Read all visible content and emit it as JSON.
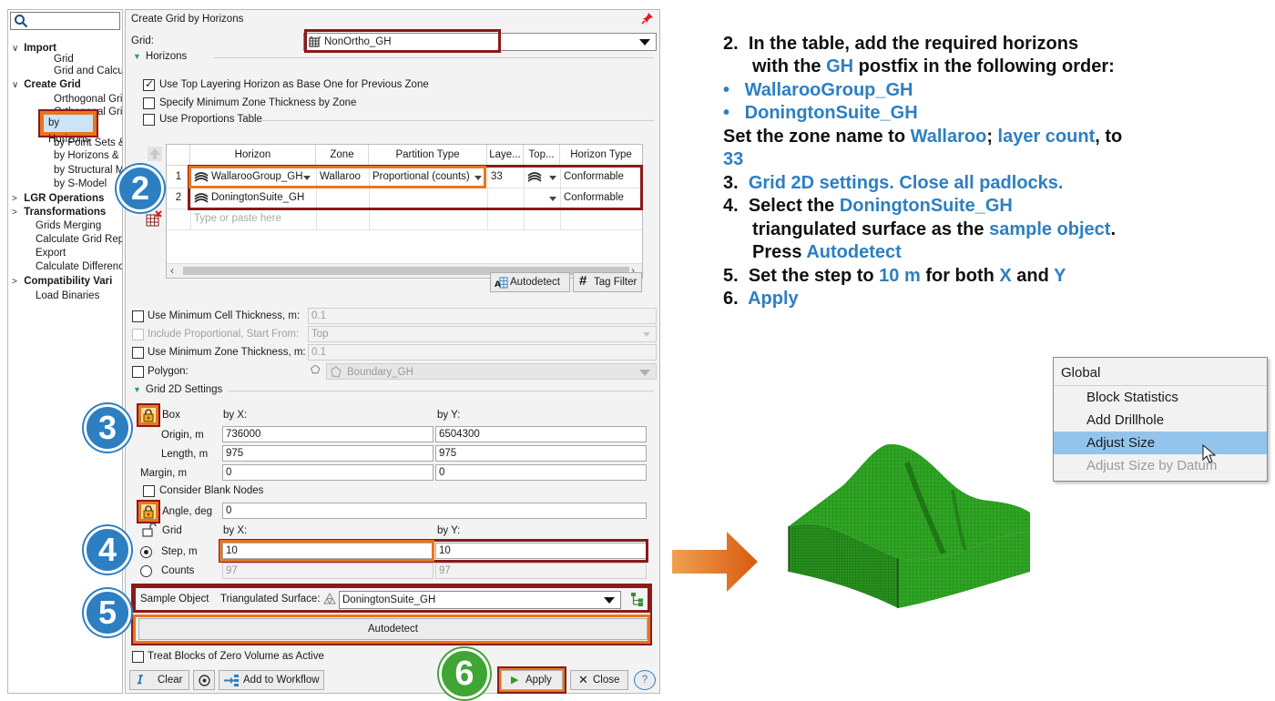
{
  "tree": {
    "search_placeholder": "",
    "items": [
      {
        "label": "Import",
        "level": 0,
        "bold": true,
        "chevron": "∨"
      },
      {
        "label": "Grid",
        "level": 1
      },
      {
        "label": "Grid and Calcu",
        "level": 1
      },
      {
        "label": "Create Grid",
        "level": 0,
        "bold": true,
        "chevron": "∨"
      },
      {
        "label": "Orthogonal Gri",
        "level": 1
      },
      {
        "label": "Orthogonal Gri",
        "level": 1
      },
      {
        "label": "by Horizons",
        "level": 1,
        "selected": true
      },
      {
        "label": "by Point Sets &",
        "level": 1
      },
      {
        "label": "by Horizons &",
        "level": 1
      },
      {
        "label": "by Structural M",
        "level": 1
      },
      {
        "label": "by S-Model",
        "level": 1
      },
      {
        "label": "LGR Operations",
        "level": 0,
        "bold": true,
        "chevron": ">"
      },
      {
        "label": "Transformations",
        "level": 0,
        "bold": true,
        "chevron": ">"
      },
      {
        "label": "Grids Merging",
        "level": 0
      },
      {
        "label": "Calculate Grid Rep",
        "level": 0
      },
      {
        "label": "Export",
        "level": 0
      },
      {
        "label": "Calculate Differenc",
        "level": 0
      },
      {
        "label": "Compatibility Vari",
        "level": 0,
        "bold": true,
        "chevron": ">"
      },
      {
        "label": "Load Binaries",
        "level": 0
      }
    ]
  },
  "dialog": {
    "title": "Create Grid by Horizons",
    "grid_label": "Grid:",
    "grid_value": "NonOrtho_GH",
    "horizons_section": "Horizons",
    "opt_top_layering": "Use Top Layering Horizon as Base One for Previous Zone",
    "opt_min_zone_by_zone": "Specify Minimum Zone Thickness by Zone",
    "opt_proportions_table": "Use Proportions Table",
    "table": {
      "headers": [
        "Horizon",
        "Zone",
        "Partition Type",
        "Laye...",
        "Top...",
        "Horizon Type"
      ],
      "rows": [
        {
          "num": "1",
          "horizon": "WallarooGroup_GH",
          "zone": "Wallaroo",
          "partition": "Proportional (counts)",
          "layers": "33",
          "horizon_type": "Conformable"
        },
        {
          "num": "2",
          "horizon": "DoningtonSuite_GH",
          "zone": "",
          "partition": "",
          "layers": "",
          "horizon_type": "Conformable"
        }
      ],
      "new_row_placeholder": "Type or paste here"
    },
    "autodetect_small": "Autodetect",
    "tag_filter": "Tag Filter",
    "min_cell_label": "Use Minimum Cell Thickness, m:",
    "min_cell_value": "0.1",
    "include_prop_label": "Include Proportional, Start From:",
    "include_prop_value": "Top",
    "min_zone_label": "Use Minimum Zone Thickness, m:",
    "min_zone_value": "0.1",
    "polygon_label": "Polygon:",
    "polygon_value": "Boundary_GH",
    "grid2d_section": "Grid 2D Settings",
    "box_label": "Box",
    "by_x": "by X:",
    "by_y": "by Y:",
    "origin_label": "Origin, m",
    "origin_x": "736000",
    "origin_y": "6504300",
    "length_label": "Length, m",
    "length_x": "975",
    "length_y": "975",
    "margin_label": "Margin, m",
    "margin_x": "0",
    "margin_y": "0",
    "consider_blank": "Consider Blank Nodes",
    "angle_label": "Angle, deg",
    "angle_value": "0",
    "grid_sub_label": "Grid",
    "by_x2": "by X:",
    "by_y2": "by Y:",
    "step_label": "Step, m",
    "step_x": "10",
    "step_y": "10",
    "counts_label": "Counts",
    "counts_x": "97",
    "counts_y": "97",
    "sample_object_label": "Sample Object",
    "triangulated_label": "Triangulated Surface:",
    "sample_value": "DoningtonSuite_GH",
    "autodetect_big": "Autodetect",
    "treat_blocks": "Treat Blocks of Zero Volume as Active",
    "clear": "Clear",
    "add_workflow": "Add to Workflow",
    "apply": "Apply",
    "close": "Close",
    "help": "?"
  },
  "steps": {
    "s2": "2",
    "s3": "3",
    "s4": "4",
    "s5": "5",
    "s6": "6"
  },
  "instructions": {
    "l1_num": "2.",
    "l1a": "In the table, add the required horizons",
    "l2a": "with the ",
    "l2b": "GH",
    "l2c": " postfix in the following order:",
    "b1": "WallarooGroup_GH",
    "b2": "DoningtonSuite_GH",
    "l5a": "Set the zone name to ",
    "l5b": "Wallaroo",
    "l5c": "; ",
    "l5d": "layer count",
    "l5e": ", to",
    "l6": "33",
    "l7_num": "3.",
    "l7": "Grid 2D settings. Close all padlocks.",
    "l8_num": "4.",
    "l8a": "Select the ",
    "l8b": "DoningtonSuite_GH",
    "l9a": "triangulated surface as the ",
    "l9b": "sample object",
    "l9c": ".",
    "l10a": "Press ",
    "l10b": "Autodetect",
    "l11_num": "5.",
    "l11a": "Set the step to ",
    "l11b": "10 m",
    "l11c": " for both ",
    "l11d": "X",
    "l11e": " and ",
    "l11f": "Y",
    "l12_num": "6.",
    "l12": "Apply"
  },
  "context_menu": {
    "header": "Global",
    "items": [
      "Block Statistics",
      "Add Drillhole",
      "Adjust Size",
      "Adjust Size by Datum"
    ]
  },
  "colors": {
    "accent_blue": "#2d7fc1",
    "orange": "#e8761c",
    "dark_red": "#8b1a1a",
    "green": "#3fa535",
    "grid_green": "#2e9b22"
  }
}
